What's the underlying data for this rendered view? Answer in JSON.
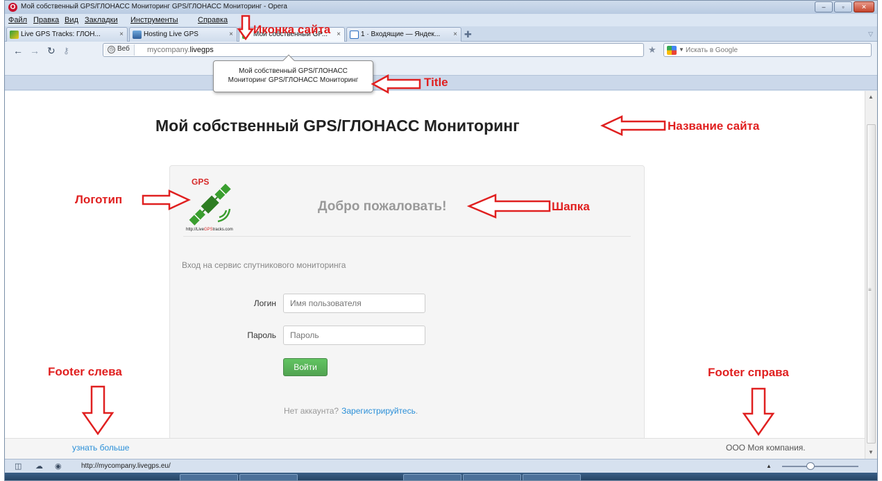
{
  "window": {
    "title": "Мой собственный GPS/ГЛОНАСС Мониторинг GPS/ГЛОНАСС Мониторинг - Opera",
    "browser_icon": "O",
    "minimize": "–",
    "maximize": "▫",
    "close": "✕"
  },
  "menu": [
    "Файл",
    "Правка",
    "Вид",
    "Закладки",
    "Инструменты",
    "Справка"
  ],
  "tabs": [
    {
      "label": "Live GPS Tracks: ГЛОН...",
      "close": "×"
    },
    {
      "label": "Hosting Live GPS",
      "close": "×"
    },
    {
      "label": "Мой собственный GP...",
      "close": "×"
    },
    {
      "label": "1 · Входящие — Яндек...",
      "close": "×"
    }
  ],
  "tab_add": "✚",
  "nav": {
    "back": "←",
    "forward": "→",
    "reload": "↻",
    "key": "⚷",
    "web_label": "Веб",
    "url_prefix": "mycompany.",
    "url_domain": "livegps",
    "star": "★",
    "search_placeholder": "Искать в Google"
  },
  "tooltip": {
    "line1": "Мой собственный GPS/ГЛОНАСС",
    "line2": "Мониторинг GPS/ГЛОНАСС Мониторинг"
  },
  "page": {
    "site_title": "Мой собственный GPS/ГЛОНАСС Мониторинг",
    "logo_gps": "GPS",
    "logo_url_prefix": "http://Live",
    "logo_url_mid": "GPS",
    "logo_url_suffix": "tracks.com",
    "welcome": "Добро пожаловать!",
    "subtitle": "Вход на сервис спутникового мониторинга",
    "login_label": "Логин",
    "login_placeholder": "Имя пользователя",
    "password_label": "Пароль",
    "password_placeholder": "Пароль",
    "login_button": "Войти",
    "no_account": "Нет аккаунта?",
    "register": "Зарегистрируйтесь",
    "register_dot": "."
  },
  "footer": {
    "left": "узнать больше",
    "right": "ООО Моя компания."
  },
  "status": {
    "url": "http://mycompany.livegps.eu/"
  },
  "annotations": {
    "site_icon": "Иконка сайта",
    "title": "Title",
    "site_name": "Название сайта",
    "logo": "Логотип",
    "header": "Шапка",
    "footer_left": "Footer слева",
    "footer_right": "Footer справа"
  },
  "colors": {
    "annotation": "#e02020",
    "link": "#2a8fd8",
    "button": "#5bb75b"
  }
}
